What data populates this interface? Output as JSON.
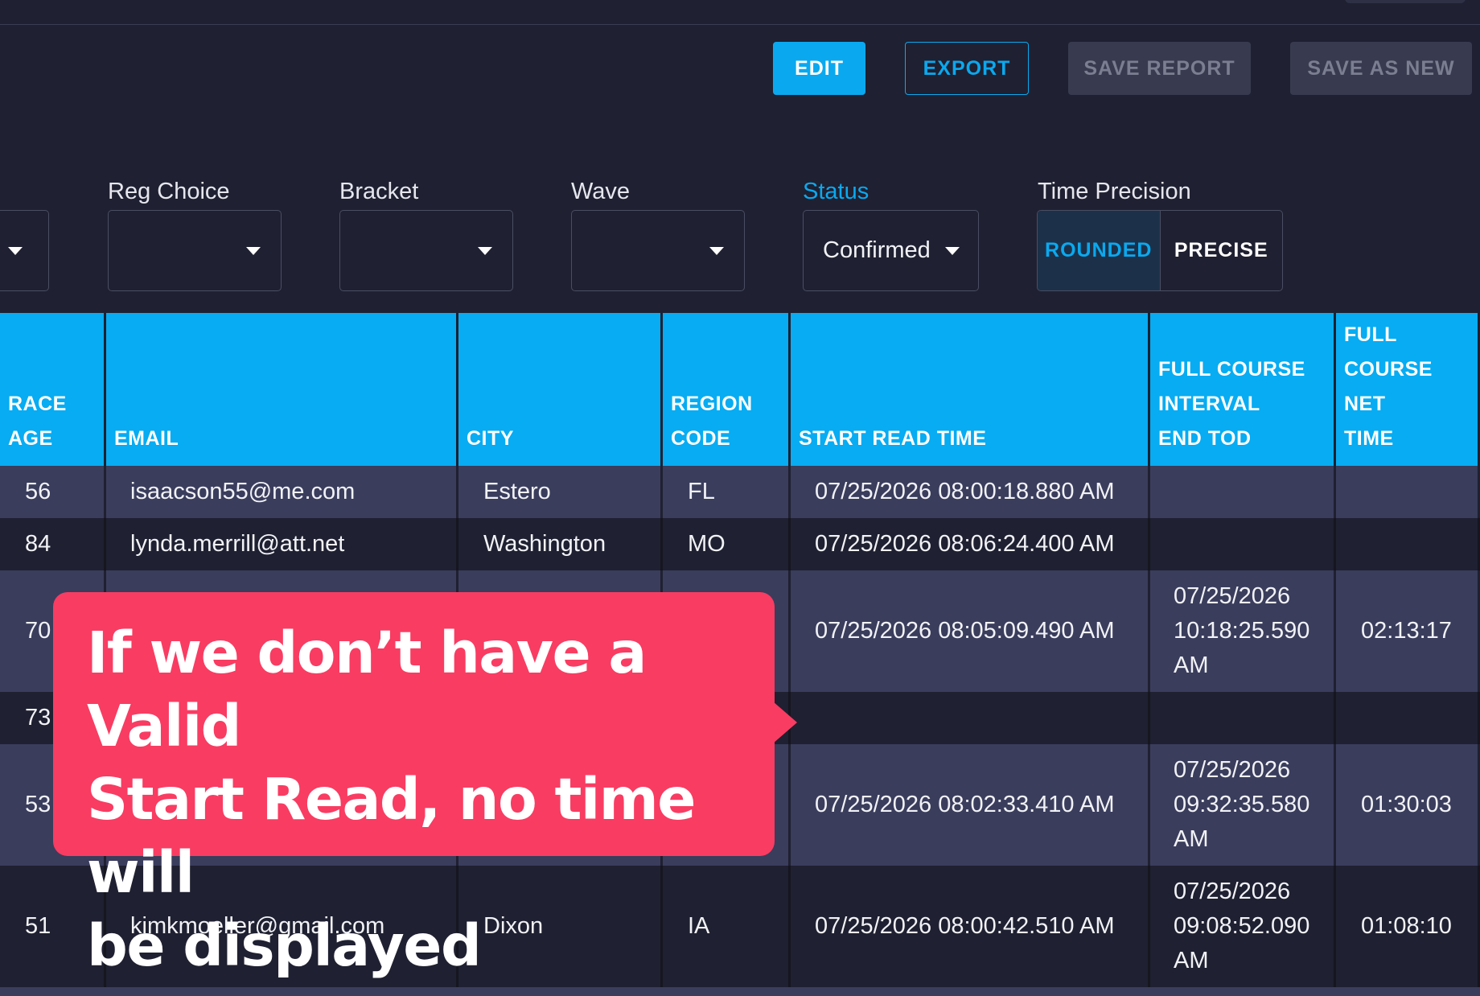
{
  "toolbar": {
    "edit": "EDIT",
    "export": "EXPORT",
    "save_report": "SAVE REPORT",
    "save_as_new": "SAVE AS NEW"
  },
  "filters": {
    "reg_choice": {
      "label": "Reg Choice",
      "value": ""
    },
    "bracket": {
      "label": "Bracket",
      "value": ""
    },
    "wave": {
      "label": "Wave",
      "value": ""
    },
    "status": {
      "label": "Status",
      "value": "Confirmed"
    },
    "time_precision": {
      "label": "Time Precision",
      "options": [
        "ROUNDED",
        "PRECISE"
      ],
      "selected": "ROUNDED"
    }
  },
  "table": {
    "headers": {
      "race_age": [
        "RACE",
        "AGE"
      ],
      "email": [
        "EMAIL"
      ],
      "city": [
        "CITY"
      ],
      "region": [
        "REGION",
        "CODE"
      ],
      "start": [
        "START READ TIME"
      ],
      "interval": [
        "FULL COURSE",
        "INTERVAL",
        "END TOD"
      ],
      "net": [
        "FULL",
        "COURSE",
        "NET",
        "TIME"
      ]
    },
    "rows": [
      {
        "age": "56",
        "email": "isaacson55@me.com",
        "city": "Estero",
        "region": "FL",
        "start": "07/25/2026 08:00:18.880 AM",
        "end": [
          "",
          "",
          ""
        ],
        "net": ""
      },
      {
        "age": "84",
        "email": "lynda.merrill@att.net",
        "city": "Washington",
        "region": "MO",
        "start": "07/25/2026 08:06:24.400 AM",
        "end": [
          "",
          "",
          ""
        ],
        "net": ""
      },
      {
        "age": "70",
        "email": "",
        "city": "",
        "region": "",
        "start": "07/25/2026 08:05:09.490 AM",
        "end": [
          "07/25/2026",
          "10:18:25.590",
          "AM"
        ],
        "net": "02:13:17"
      },
      {
        "age": "73",
        "email": "",
        "city": "",
        "region": "",
        "start": "",
        "end": [
          "",
          "",
          ""
        ],
        "net": ""
      },
      {
        "age": "53",
        "email": "",
        "city": "",
        "region": "",
        "start": "07/25/2026 08:02:33.410 AM",
        "end": [
          "07/25/2026",
          "09:32:35.580",
          "AM"
        ],
        "net": "01:30:03"
      },
      {
        "age": "51",
        "email": "kimkmoeller@gmail.com",
        "city": "Dixon",
        "region": "IA",
        "start": "07/25/2026 08:00:42.510 AM",
        "end": [
          "07/25/2026",
          "09:08:52.090",
          "AM"
        ],
        "net": "01:08:10"
      }
    ]
  },
  "callout": {
    "lines": [
      "If we don’t have a Valid",
      "Start Read, no time will",
      "be displayed"
    ]
  },
  "colors": {
    "accent": "#0aa9ef",
    "background": "#1f2031",
    "row_light": "#3a3d5c",
    "callout": "#f93c62"
  }
}
